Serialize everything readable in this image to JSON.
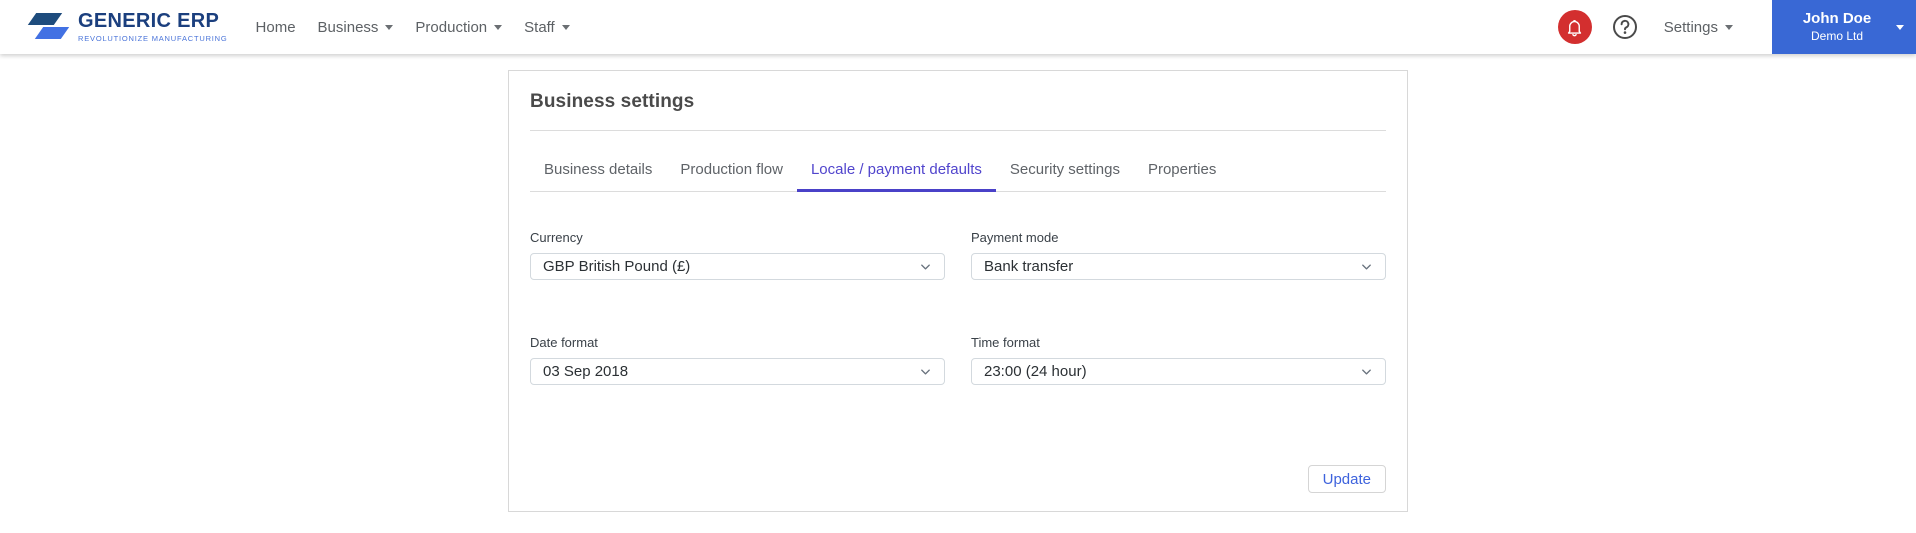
{
  "brand": {
    "name": "GENERIC ERP",
    "tagline": "REVOLUTIONIZE MANUFACTURING"
  },
  "nav": {
    "items": [
      {
        "label": "Home",
        "dropdown": false
      },
      {
        "label": "Business",
        "dropdown": true
      },
      {
        "label": "Production",
        "dropdown": true
      },
      {
        "label": "Staff",
        "dropdown": true
      }
    ],
    "settings_label": "Settings"
  },
  "icons": {
    "notifications": "bell-icon",
    "help": "question-mark-icon",
    "dropdown": "chevron-down-icon"
  },
  "user": {
    "name": "John Doe",
    "company": "Demo Ltd"
  },
  "card": {
    "title": "Business settings",
    "tabs": [
      {
        "label": "Business details",
        "active": false
      },
      {
        "label": "Production flow",
        "active": false
      },
      {
        "label": "Locale / payment defaults",
        "active": true
      },
      {
        "label": "Security settings",
        "active": false
      },
      {
        "label": "Properties",
        "active": false
      }
    ],
    "fields": [
      {
        "label": "Currency",
        "value": "GBP British Pound (£)"
      },
      {
        "label": "Payment mode",
        "value": "Bank transfer"
      },
      {
        "label": "Date format",
        "value": "03 Sep 2018"
      },
      {
        "label": "Time format",
        "value": "23:00 (24 hour)"
      }
    ],
    "update_label": "Update"
  },
  "colors": {
    "active_tab": "#5145cd",
    "tab_underline": "#4a41c8",
    "user_box_blue": "#3968d5",
    "bell_red": "#d32f2f",
    "update_blue": "#3e63dd",
    "brand_navy": "#1b3f7e",
    "brand_blue": "#4271e3"
  }
}
